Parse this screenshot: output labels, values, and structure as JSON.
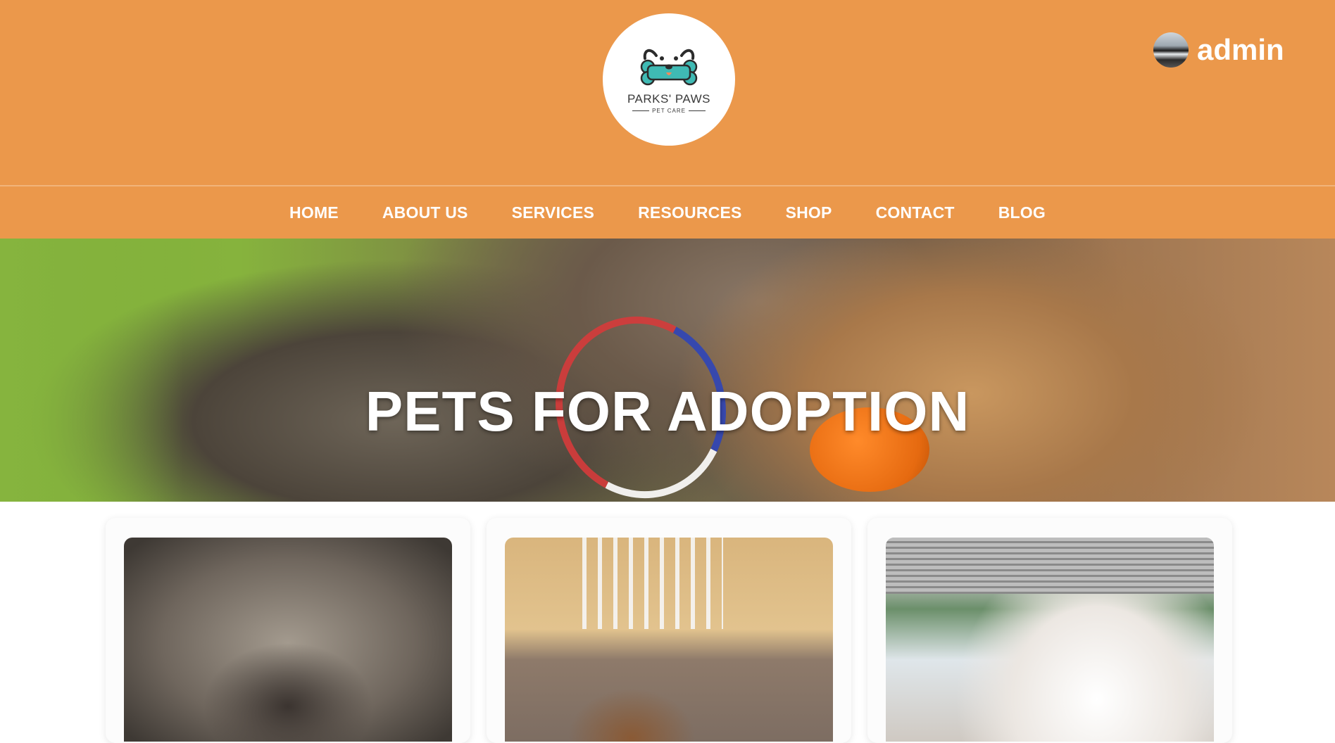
{
  "header": {
    "logo": {
      "title": "PARKS' PAWS",
      "subtitle": "PET CARE",
      "icon": "dog-bone-logo-icon"
    },
    "user": {
      "name": "admin",
      "avatar_icon": "user-avatar"
    }
  },
  "nav": {
    "items": [
      {
        "label": "HOME"
      },
      {
        "label": "ABOUT US"
      },
      {
        "label": "SERVICES"
      },
      {
        "label": "RESOURCES"
      },
      {
        "label": "SHOP"
      },
      {
        "label": "CONTACT"
      },
      {
        "label": "BLOG"
      }
    ]
  },
  "hero": {
    "title": "PETS FOR ADOPTION"
  },
  "cards": [
    {
      "image": "guinea-pig-photo"
    },
    {
      "image": "brown-doodle-dog-photo"
    },
    {
      "image": "white-doodle-dog-photo"
    }
  ],
  "colors": {
    "header_bg": "#eb984b",
    "text_on_brand": "#ffffff",
    "logo_teal": "#3fbab4"
  }
}
